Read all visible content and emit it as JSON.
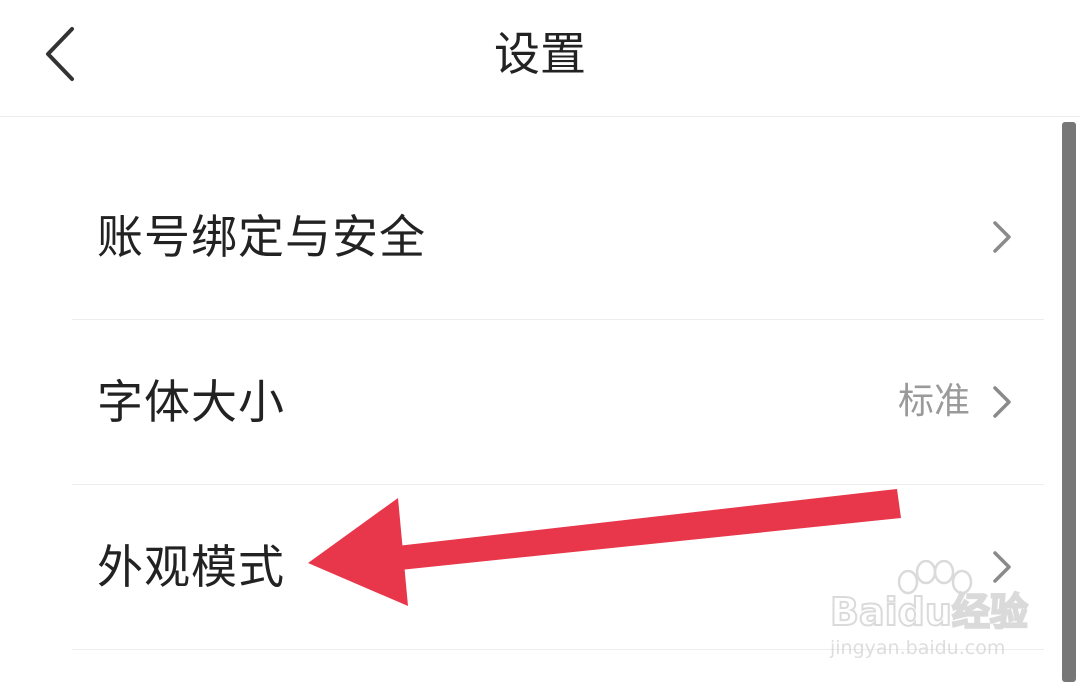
{
  "header": {
    "title": "设置",
    "back_icon": "chevron-left-icon"
  },
  "settings": {
    "items": [
      {
        "label": "账号绑定与安全",
        "value": "",
        "icon": "chevron-right-icon"
      },
      {
        "label": "字体大小",
        "value": "标准",
        "icon": "chevron-right-icon"
      },
      {
        "label": "外观模式",
        "value": "",
        "icon": "chevron-right-icon"
      }
    ]
  },
  "annotation": {
    "color": "#e8364a",
    "icon": "red-arrow-pointer"
  },
  "watermark": {
    "brand": "Baidu经验",
    "url": "jingyan.baidu.com"
  },
  "colors": {
    "text": "#222222",
    "secondary_text": "#9a9a9a",
    "divider": "#eeeeee",
    "background": "#ffffff"
  }
}
